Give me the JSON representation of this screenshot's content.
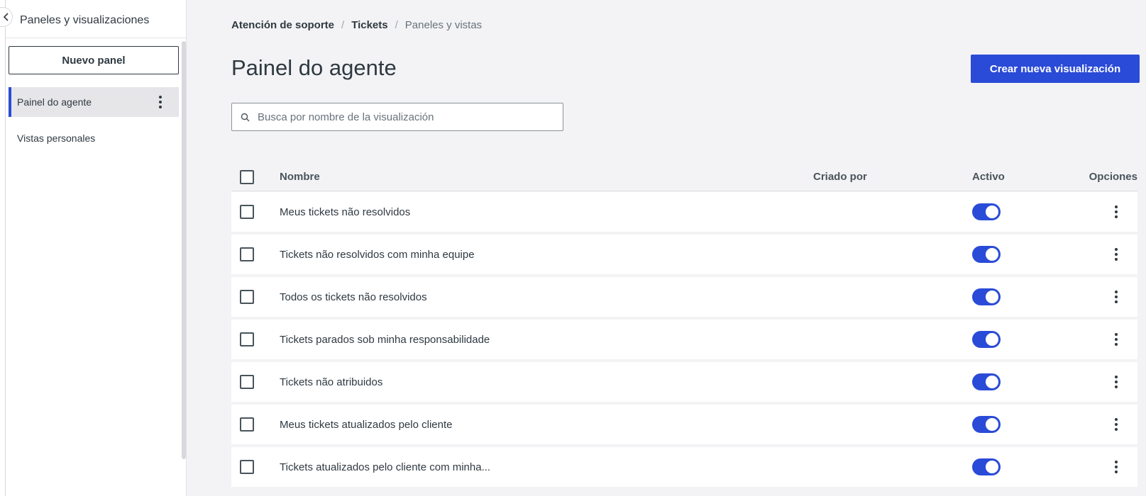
{
  "sidebar": {
    "title": "Paneles y visualizaciones",
    "new_panel_label": "Nuevo panel",
    "items": [
      {
        "label": "Painel do agente",
        "active": true
      },
      {
        "label": "Vistas personales",
        "active": false
      }
    ]
  },
  "breadcrumb": [
    "Atención de soporte",
    "Tickets",
    "Paneles y vistas"
  ],
  "page_title": "Painel do agente",
  "create_button_label": "Crear nueva visualización",
  "search": {
    "placeholder": "Busca por nombre de la visualización",
    "value": ""
  },
  "table": {
    "columns": {
      "name": "Nombre",
      "created_by": "Criado por",
      "active": "Activo",
      "options": "Opciones"
    },
    "rows": [
      {
        "name": "Meus tickets não resolvidos",
        "created_by": "",
        "active": true
      },
      {
        "name": "Tickets não resolvidos com minha equipe",
        "created_by": "",
        "active": true
      },
      {
        "name": "Todos os tickets não resolvidos",
        "created_by": "",
        "active": true
      },
      {
        "name": "Tickets parados sob minha responsabilidade",
        "created_by": "",
        "active": true
      },
      {
        "name": "Tickets não atribuidos",
        "created_by": "",
        "active": true
      },
      {
        "name": "Meus tickets atualizados pelo cliente",
        "created_by": "",
        "active": true
      },
      {
        "name": "Tickets atualizados pelo cliente com minha...",
        "created_by": "",
        "active": true
      }
    ]
  },
  "colors": {
    "accent": "#2a4bd7",
    "text": "#2f3941",
    "background": "#f3f3f5"
  }
}
